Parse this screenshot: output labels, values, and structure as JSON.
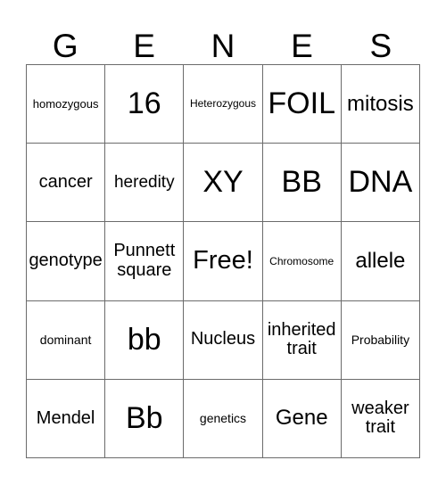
{
  "card": {
    "title_letters": [
      "G",
      "E",
      "N",
      "E",
      "S"
    ],
    "rows": [
      [
        {
          "text": "homozygous",
          "size": "sm"
        },
        {
          "text": "16",
          "size": "xxl"
        },
        {
          "text": "Heterozygous",
          "size": "xs"
        },
        {
          "text": "FOIL",
          "size": "xxl"
        },
        {
          "text": "mitosis",
          "size": "lg"
        }
      ],
      [
        {
          "text": "cancer",
          "size": "md2"
        },
        {
          "text": "heredity",
          "size": "md"
        },
        {
          "text": "XY",
          "size": "xxl"
        },
        {
          "text": "BB",
          "size": "xxl"
        },
        {
          "text": "DNA",
          "size": "xxl"
        }
      ],
      [
        {
          "text": "genotype",
          "size": "md2"
        },
        {
          "text": "Punnett\nsquare",
          "size": "md2"
        },
        {
          "text": "Free!",
          "size": "xl"
        },
        {
          "text": "Chromosome",
          "size": "xs"
        },
        {
          "text": "allele",
          "size": "lg"
        }
      ],
      [
        {
          "text": "dominant",
          "size": "sm2"
        },
        {
          "text": "bb",
          "size": "xxl"
        },
        {
          "text": "Nucleus",
          "size": "md2"
        },
        {
          "text": "inherited\ntrait",
          "size": "md2"
        },
        {
          "text": "Probability",
          "size": "sm2"
        }
      ],
      [
        {
          "text": "Mendel",
          "size": "md2"
        },
        {
          "text": "Bb",
          "size": "xxl"
        },
        {
          "text": "genetics",
          "size": "sm2"
        },
        {
          "text": "Gene",
          "size": "lg"
        },
        {
          "text": "weaker\ntrait",
          "size": "md2"
        }
      ]
    ],
    "colors": {
      "border": "#6b6b6b",
      "text": "#000000",
      "background": "#ffffff"
    }
  }
}
